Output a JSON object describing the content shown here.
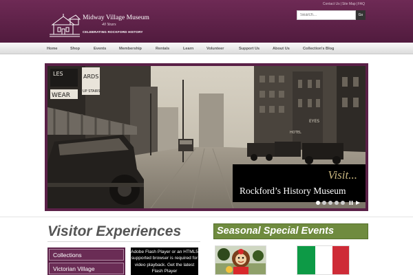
{
  "header": {
    "logo_title": "Midway Village Museum",
    "logo_anniversary": "40 Years",
    "logo_tagline": "CELEBRATING ROCKFORD HISTORY",
    "top_links": [
      "Contact Us",
      "Site Map",
      "FAQ"
    ],
    "search": {
      "placeholder": "Search...",
      "button_label": "Go"
    }
  },
  "nav": {
    "items": [
      "Home",
      "Shop",
      "Events",
      "Membership",
      "Rentals",
      "Learn",
      "Volunteer",
      "Support Us",
      "About Us",
      "Collection's Blog"
    ]
  },
  "slider": {
    "caption_visit": "Visit...",
    "caption_main": "Rockford’s History Museum",
    "slide_count": 5,
    "active_slide": 1,
    "storefront_signs": [
      "WEAR",
      "ARDS",
      "UP STAIRS",
      "HOTEL",
      "EYES"
    ]
  },
  "visitor": {
    "heading": "Visitor Experiences",
    "categories": [
      "Collections",
      "Victorian Village"
    ],
    "flash_notice": "Adobe Flash Player or an HTML5 supported browser is required for video playback. Get the latest Flash Player"
  },
  "seasonal": {
    "heading": "Seasonal Special Events"
  },
  "colors": {
    "header_top": "#6e2a55",
    "header_bottom": "#511b3e",
    "slider_frame": "#5a2047",
    "seasonal_green": "#6f8b3f",
    "caption_gold": "#c7b47e"
  }
}
